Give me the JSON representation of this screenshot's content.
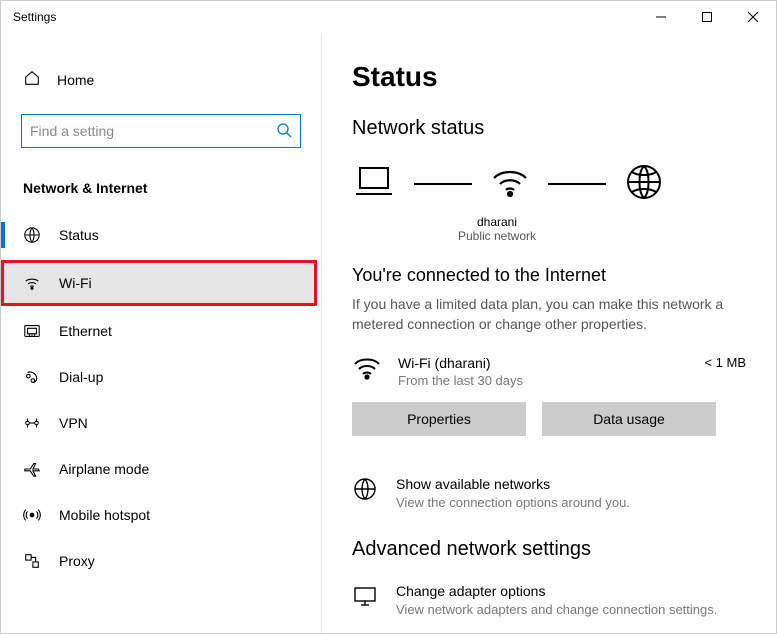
{
  "window": {
    "title": "Settings"
  },
  "sidebar": {
    "home": "Home",
    "searchPlaceholder": "Find a setting",
    "category": "Network & Internet",
    "items": [
      {
        "label": "Status"
      },
      {
        "label": "Wi-Fi"
      },
      {
        "label": "Ethernet"
      },
      {
        "label": "Dial-up"
      },
      {
        "label": "VPN"
      },
      {
        "label": "Airplane mode"
      },
      {
        "label": "Mobile hotspot"
      },
      {
        "label": "Proxy"
      }
    ]
  },
  "main": {
    "title": "Status",
    "subtitle": "Network status",
    "diagram": {
      "ssid": "dharani",
      "networkType": "Public network"
    },
    "connected": {
      "headline": "You're connected to the Internet",
      "detail": "If you have a limited data plan, you can make this network a metered connection or change other properties."
    },
    "connection": {
      "name": "Wi-Fi (dharani)",
      "period": "From the last 30 days",
      "usage": "< 1 MB"
    },
    "buttons": {
      "properties": "Properties",
      "dataUsage": "Data usage"
    },
    "showNetworks": {
      "title": "Show available networks",
      "desc": "View the connection options around you."
    },
    "advanced": {
      "heading": "Advanced network settings",
      "adapter": {
        "title": "Change adapter options",
        "desc": "View network adapters and change connection settings."
      }
    }
  }
}
